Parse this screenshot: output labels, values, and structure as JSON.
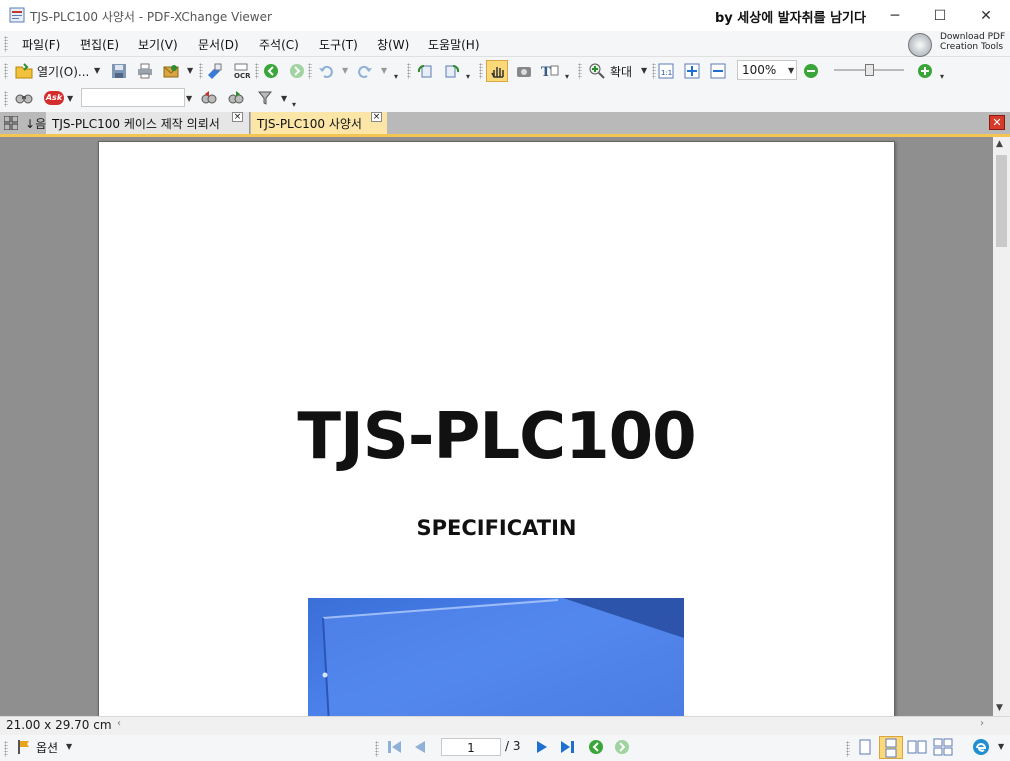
{
  "window": {
    "title": "TJS-PLC100 사양서 - PDF-XChange Viewer",
    "byline": "by 세상에 발자취를 남기다",
    "minimize": "─",
    "maximize": "☐",
    "close": "✕"
  },
  "menu": [
    "파일(F)",
    "편집(E)",
    "보기(V)",
    "문서(D)",
    "주석(C)",
    "도구(T)",
    "창(W)",
    "도움말(H)"
  ],
  "download_tools": {
    "line1": "Download PDF",
    "line2": "Creation Tools"
  },
  "toolbar": {
    "open_label": "열기(O)...",
    "zoom_label": "확대",
    "zoom_value": "100%",
    "zoom_slider_level": 0.5
  },
  "toolbar2": {
    "ask_label": "Ask",
    "search_value": ""
  },
  "tabs": {
    "side_label": "음",
    "items": [
      {
        "label": "TJS-PLC100 케이스 제작 의뢰서",
        "active": false
      },
      {
        "label": "TJS-PLC100 사양서",
        "active": true
      }
    ]
  },
  "document": {
    "title": "TJS-PLC100",
    "subtitle": "SPECIFICATIN"
  },
  "status": {
    "page_size": "21.00 x 29.70 cm"
  },
  "bottom": {
    "options_label": "옵션",
    "current_page": "1",
    "total_pages": "/ 3"
  },
  "colors": {
    "active_tab": "#fbe6a8",
    "tab_underline": "#f3c552",
    "viewer_bg": "#8f8f8f",
    "nav_blue": "#1f6fd1",
    "nav_green": "#3aa63a"
  }
}
